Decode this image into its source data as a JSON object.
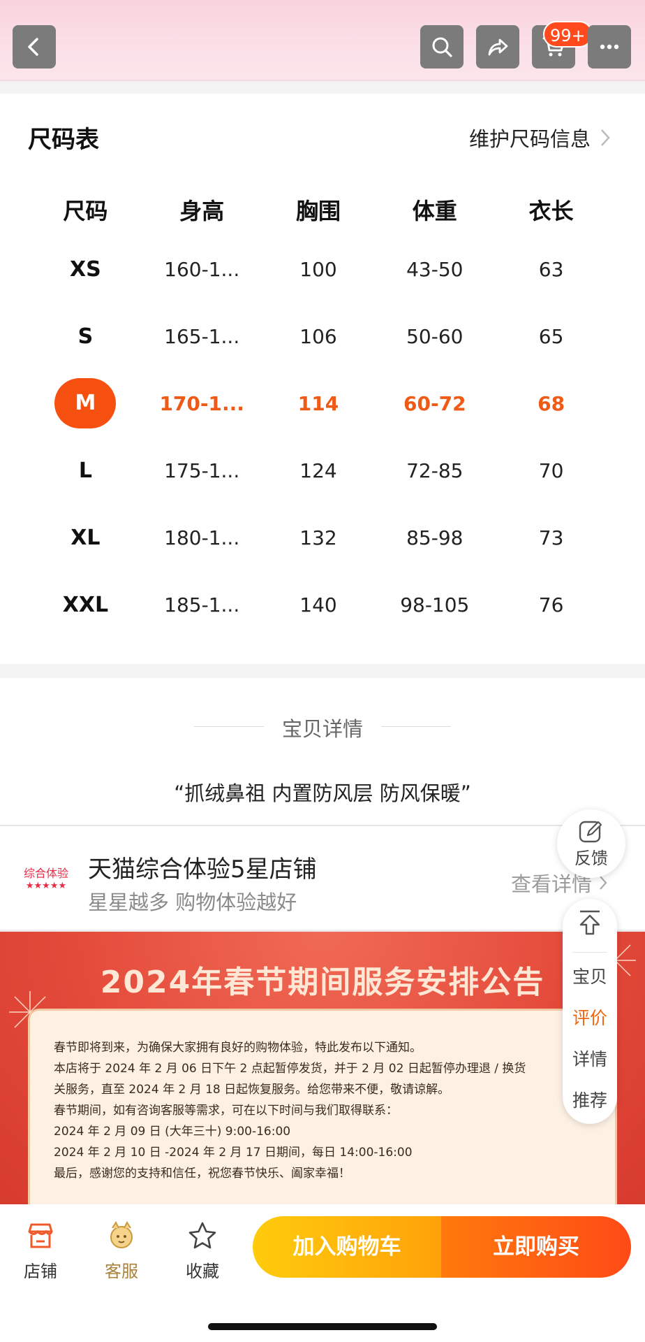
{
  "header": {
    "cart_badge": "99+",
    "icons": [
      "back-icon",
      "search-icon",
      "share-icon",
      "cart-icon",
      "more-icon"
    ]
  },
  "size_chart": {
    "title": "尺码表",
    "maintain_link": "维护尺码信息",
    "columns": [
      "尺码",
      "身高",
      "胸围",
      "体重",
      "衣长"
    ],
    "rows": [
      [
        "XS",
        "160-1...",
        "100",
        "43-50",
        "63"
      ],
      [
        "S",
        "165-1...",
        "106",
        "50-60",
        "65"
      ],
      [
        "M",
        "170-1...",
        "114",
        "60-72",
        "68"
      ],
      [
        "L",
        "175-1...",
        "124",
        "72-85",
        "70"
      ],
      [
        "XL",
        "180-1...",
        "132",
        "85-98",
        "73"
      ],
      [
        "XXL",
        "185-1...",
        "140",
        "98-105",
        "76"
      ]
    ],
    "selected": "M",
    "accent_color": "#f5500f"
  },
  "detail": {
    "title": "宝贝详情",
    "quote": "“抓绒鼻祖 内置防风层 防风保暖”"
  },
  "store": {
    "badge_text": "综合体验",
    "stars": "★★★★★",
    "title": "天猫综合体验5星店铺",
    "subtitle": "星星越多 购物体验越好",
    "more": "查看详情"
  },
  "announcement": {
    "title": "2024年春节期间服务安排公告",
    "lines": [
      "春节即将到来，为确保大家拥有良好的购物体验，特此发布以下通知。",
      "本店将于 2024 年 2 月 06 日下午 2 点起暂停发货，并于 2 月 02 日起暂停办理退 / 换货",
      "关服务，直至 2024 年 2 月 18 日起恢复服务。给您带来不便，敬请谅解。",
      "春节期间，如有咨询客服等需求，可在以下时间与我们取得联系：",
      "2024 年 2 月 09 日 (大年三十) 9:00-16:00",
      "2024 年 2 月 10 日 -2024 年 2 月 17 日期间，每日 14:00-16:00",
      "最后，感谢您的支持和信任，祝您春节快乐、阖家幸福！"
    ]
  },
  "floating": {
    "feedback": "反馈",
    "nav": [
      "宝贝",
      "评价",
      "详情",
      "推荐"
    ],
    "active": "评价"
  },
  "bottom_bar": {
    "store": "店铺",
    "service": "客服",
    "favorite": "收藏",
    "add_cart": "加入购物车",
    "buy_now": "立即购买"
  }
}
